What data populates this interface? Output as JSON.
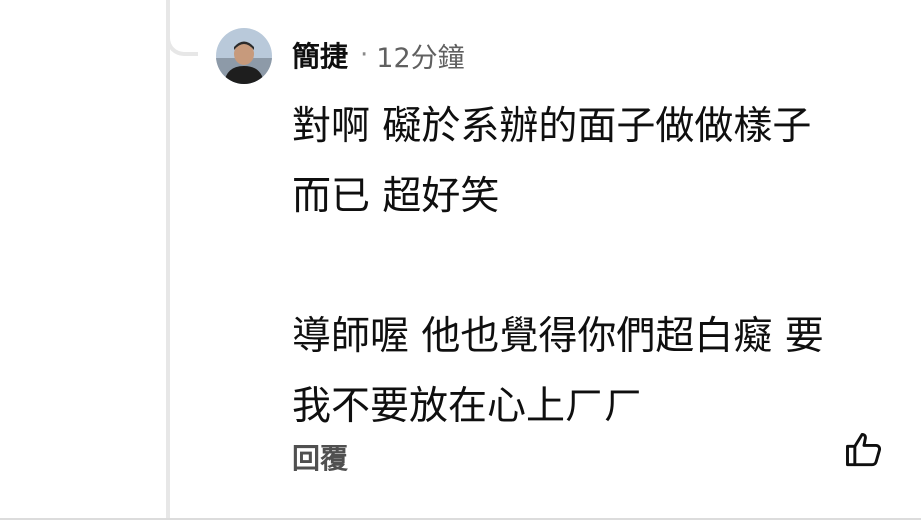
{
  "comment": {
    "author": "簡捷",
    "separator": "·",
    "time": "12分鐘",
    "lines": [
      "對啊 礙於系辦的面子做做樣子",
      "而已 超好笑",
      "",
      "導師喔 他也覺得你們超白癡 要",
      "我不要放在心上ㄏㄏ"
    ],
    "reply_label": "回覆"
  },
  "icons": {
    "avatar": "user-avatar",
    "like": "thumbs-up-icon"
  },
  "colors": {
    "text": "#0f0f0f",
    "secondary": "#606060",
    "thread_line": "#e7e7e7"
  }
}
